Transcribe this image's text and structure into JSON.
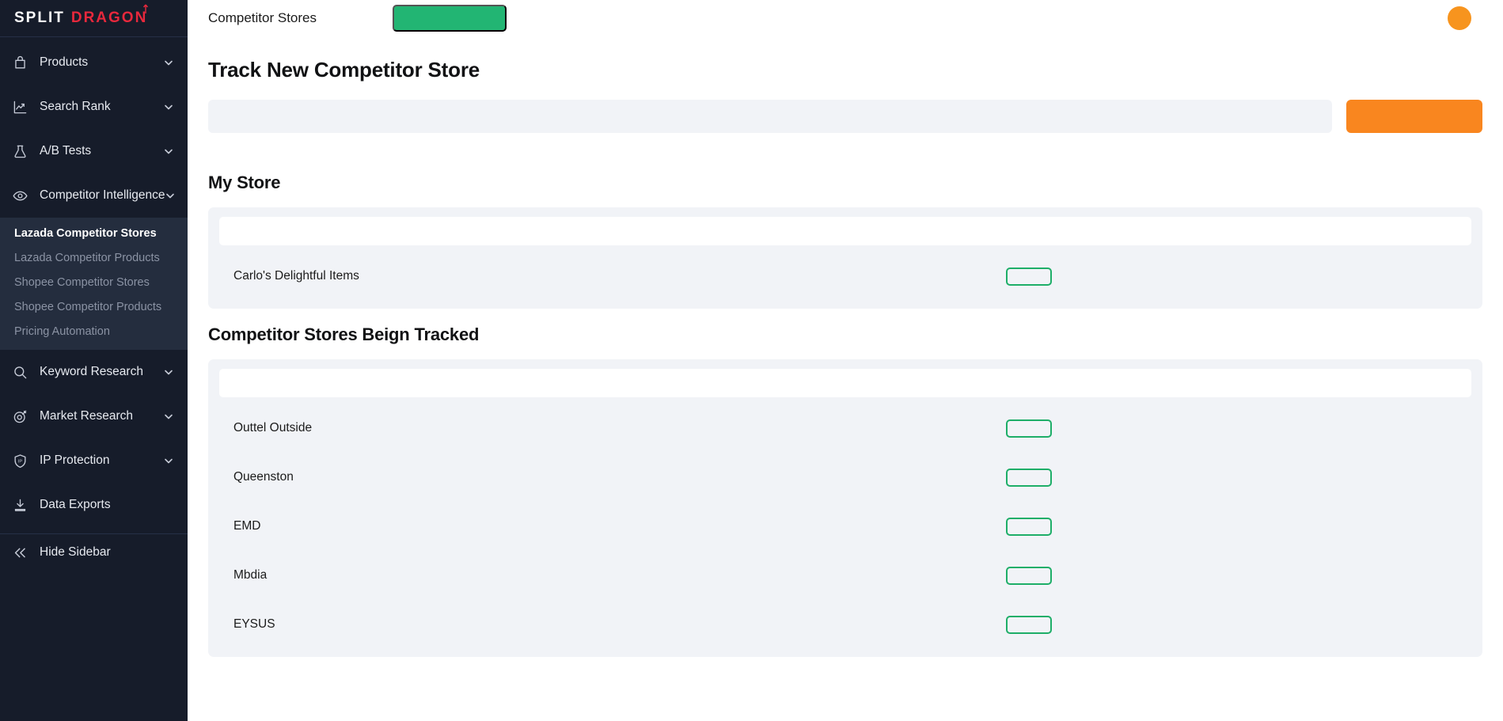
{
  "brand": {
    "name_first": "SPLIT",
    "name_second": "DRAGON"
  },
  "sidebar": {
    "items": [
      {
        "label": "Products",
        "icon": "bag-icon",
        "has_chevron": true
      },
      {
        "label": "Search Rank",
        "icon": "trending-up-chart-icon",
        "has_chevron": true
      },
      {
        "label": "A/B Tests",
        "icon": "flask-icon",
        "has_chevron": true
      },
      {
        "label": "Competitor Intelligence",
        "icon": "eye-icon",
        "has_chevron": true
      },
      {
        "label": "Keyword Research",
        "icon": "search-icon",
        "has_chevron": true
      },
      {
        "label": "Market Research",
        "icon": "target-icon",
        "has_chevron": true
      },
      {
        "label": "IP Protection",
        "icon": "shield-ip-icon",
        "has_chevron": false
      },
      {
        "label": "Data Exports",
        "icon": "download-icon",
        "has_chevron": false
      }
    ],
    "submenu": [
      {
        "label": "Lazada Competitor Stores",
        "active": true
      },
      {
        "label": "Lazada Competitor Products",
        "active": false
      },
      {
        "label": "Shopee Competitor Stores",
        "active": false
      },
      {
        "label": "Shopee Competitor Products",
        "active": false
      },
      {
        "label": "Pricing Automation",
        "active": false
      }
    ],
    "hide_sidebar": {
      "label": "Hide Sidebar",
      "icon": "chevrons-left-icon"
    }
  },
  "topbar": {
    "title": "Competitor Stores",
    "pill_label": "",
    "avatar_color": "#f7941e",
    "pill_color": "#22b573"
  },
  "main": {
    "page_title": "Track New Competitor Store",
    "track_input_value": "",
    "track_input_placeholder": "",
    "track_button_label": "",
    "my_store_title": "My Store",
    "my_store_search_value": "",
    "my_store_search_placeholder": "",
    "tracked_title": "Competitor Stores Beign Tracked",
    "tracked_search_value": "",
    "tracked_search_placeholder": "",
    "my_stores": [
      {
        "name": "Carlo's Delightful Items",
        "action_label": ""
      }
    ],
    "tracked_stores": [
      {
        "name": "Outtel Outside",
        "action_label": ""
      },
      {
        "name": "Queenston",
        "action_label": ""
      },
      {
        "name": "EMD",
        "action_label": ""
      },
      {
        "name": "Mbdia",
        "action_label": ""
      },
      {
        "name": "EYSUS",
        "action_label": ""
      }
    ]
  },
  "colors": {
    "sidebar_bg": "#161c2a",
    "submenu_bg": "#242d3e",
    "accent_orange": "#f9861f",
    "accent_green": "#22b573",
    "outline_green": "#1eae68",
    "card_bg": "#f1f3f7",
    "brand_red": "#e8283c"
  }
}
